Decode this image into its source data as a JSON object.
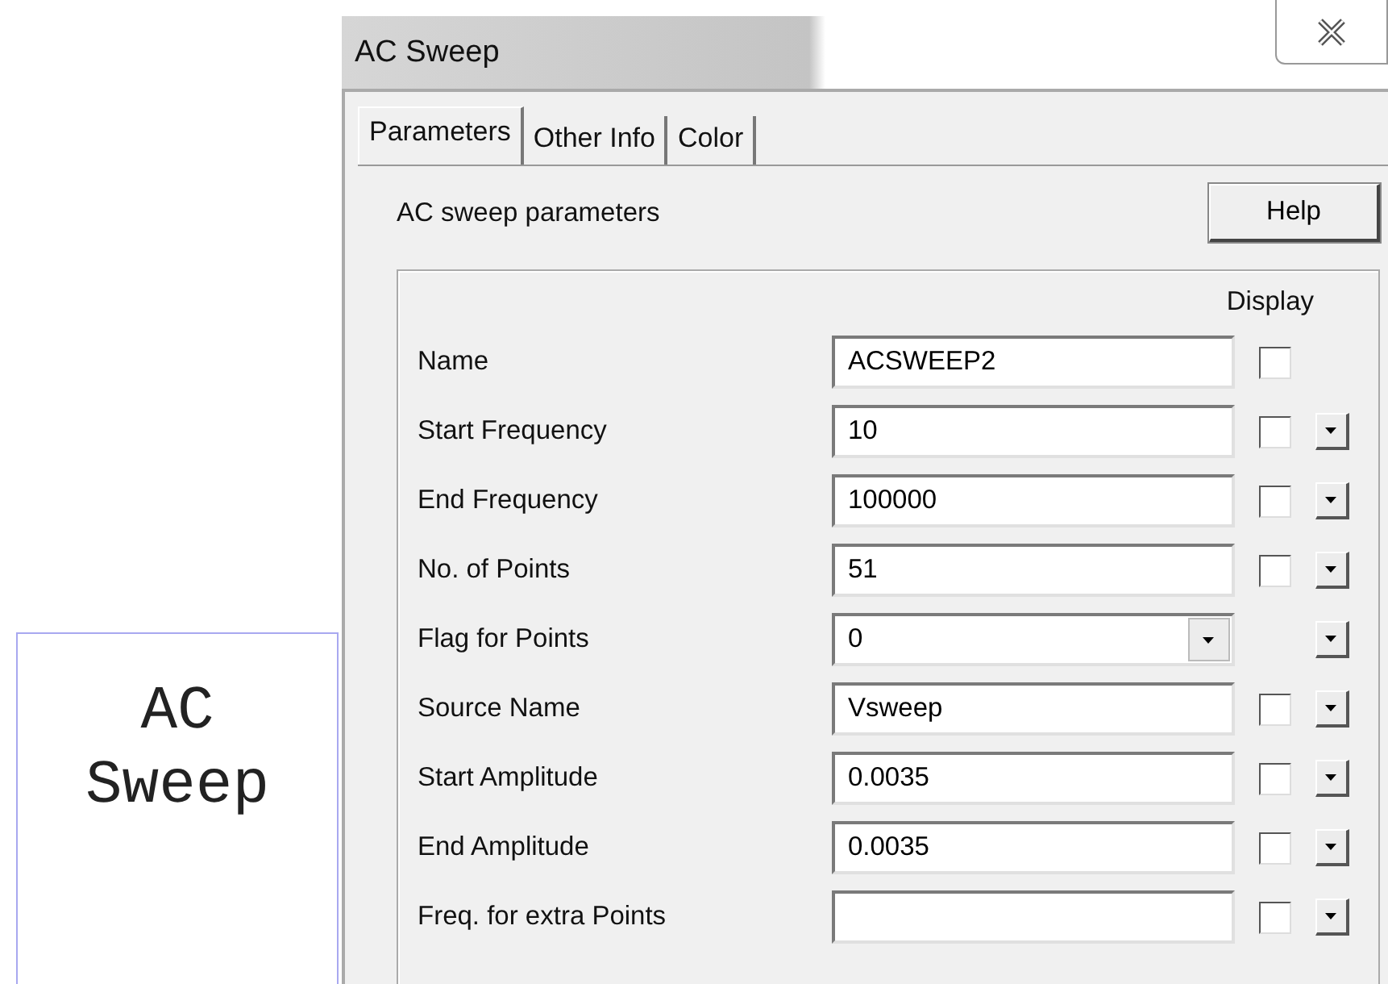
{
  "symbol": {
    "lines": [
      "AC",
      "Sweep"
    ]
  },
  "window": {
    "title": "AC Sweep"
  },
  "tabs": [
    {
      "label": "Parameters",
      "selected": true
    },
    {
      "label": "Other Info",
      "selected": false
    },
    {
      "label": "Color",
      "selected": false
    }
  ],
  "section_title": "AC sweep parameters",
  "help_button": "Help",
  "display_heading": "Display",
  "rows": [
    {
      "kind": "text",
      "label": "Name",
      "value": "ACSWEEP2",
      "display": {
        "checked": false
      },
      "menu_button": false
    },
    {
      "kind": "text",
      "label": "Start Frequency",
      "value": "10",
      "display": {
        "checked": false
      },
      "menu_button": true
    },
    {
      "kind": "text",
      "label": "End Frequency",
      "value": "100000",
      "display": {
        "checked": false
      },
      "menu_button": true
    },
    {
      "kind": "text",
      "label": "No. of Points",
      "value": "51",
      "display": {
        "checked": false
      },
      "menu_button": true
    },
    {
      "kind": "combo",
      "label": "Flag for Points",
      "value": "0",
      "menu_button": true
    },
    {
      "kind": "text",
      "label": "Source Name",
      "value": "Vsweep",
      "display": {
        "checked": false
      },
      "menu_button": true
    },
    {
      "kind": "text",
      "label": "Start Amplitude",
      "value": "0.0035",
      "display": {
        "checked": false
      },
      "menu_button": true
    },
    {
      "kind": "text",
      "label": "End Amplitude",
      "value": "0.0035",
      "display": {
        "checked": false
      },
      "menu_button": true
    },
    {
      "kind": "text",
      "label": "Freq. for extra Points",
      "display": {
        "checked": false
      },
      "menu_button": true
    }
  ]
}
